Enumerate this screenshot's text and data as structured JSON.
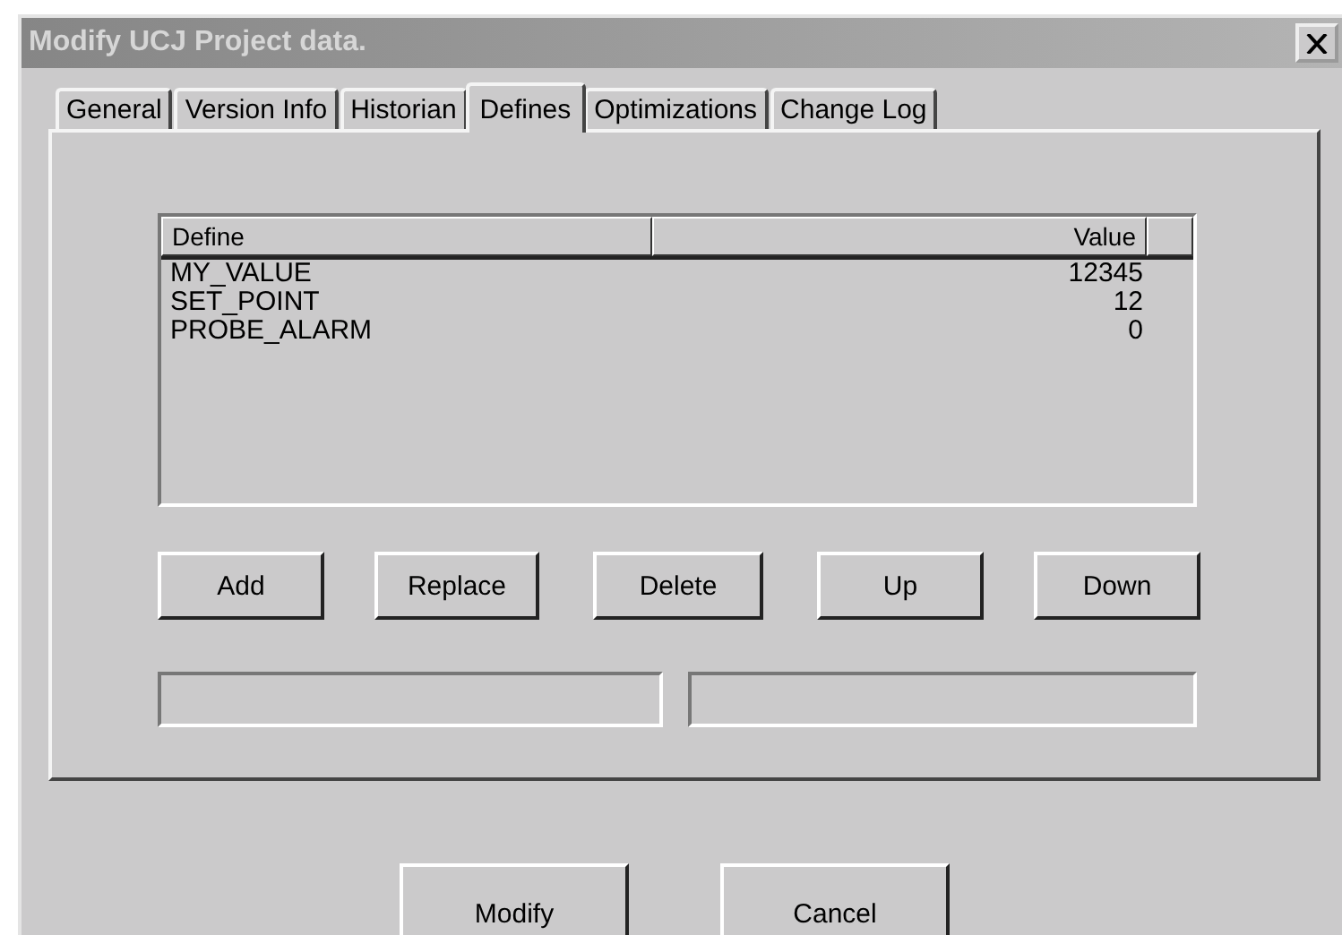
{
  "window": {
    "title": "Modify UCJ Project data.",
    "active": false
  },
  "tabs": [
    {
      "label": "General",
      "selected": false
    },
    {
      "label": "Version Info",
      "selected": false
    },
    {
      "label": "Historian",
      "selected": false
    },
    {
      "label": "Defines",
      "selected": true
    },
    {
      "label": "Optimizations",
      "selected": false
    },
    {
      "label": "Change Log",
      "selected": false
    }
  ],
  "table": {
    "columns": [
      "Define",
      "Value"
    ],
    "rows": [
      {
        "define": "MY_VALUE",
        "value": "12345"
      },
      {
        "define": "SET_POINT",
        "value": "12"
      },
      {
        "define": "PROBE_ALARM",
        "value": "0"
      }
    ]
  },
  "list_buttons": [
    "Add",
    "Replace",
    "Delete",
    "Up",
    "Down"
  ],
  "fields": [
    {
      "kind": "define"
    },
    {
      "kind": "value"
    }
  ],
  "buttons": [
    "Modify",
    "Cancel"
  ]
}
